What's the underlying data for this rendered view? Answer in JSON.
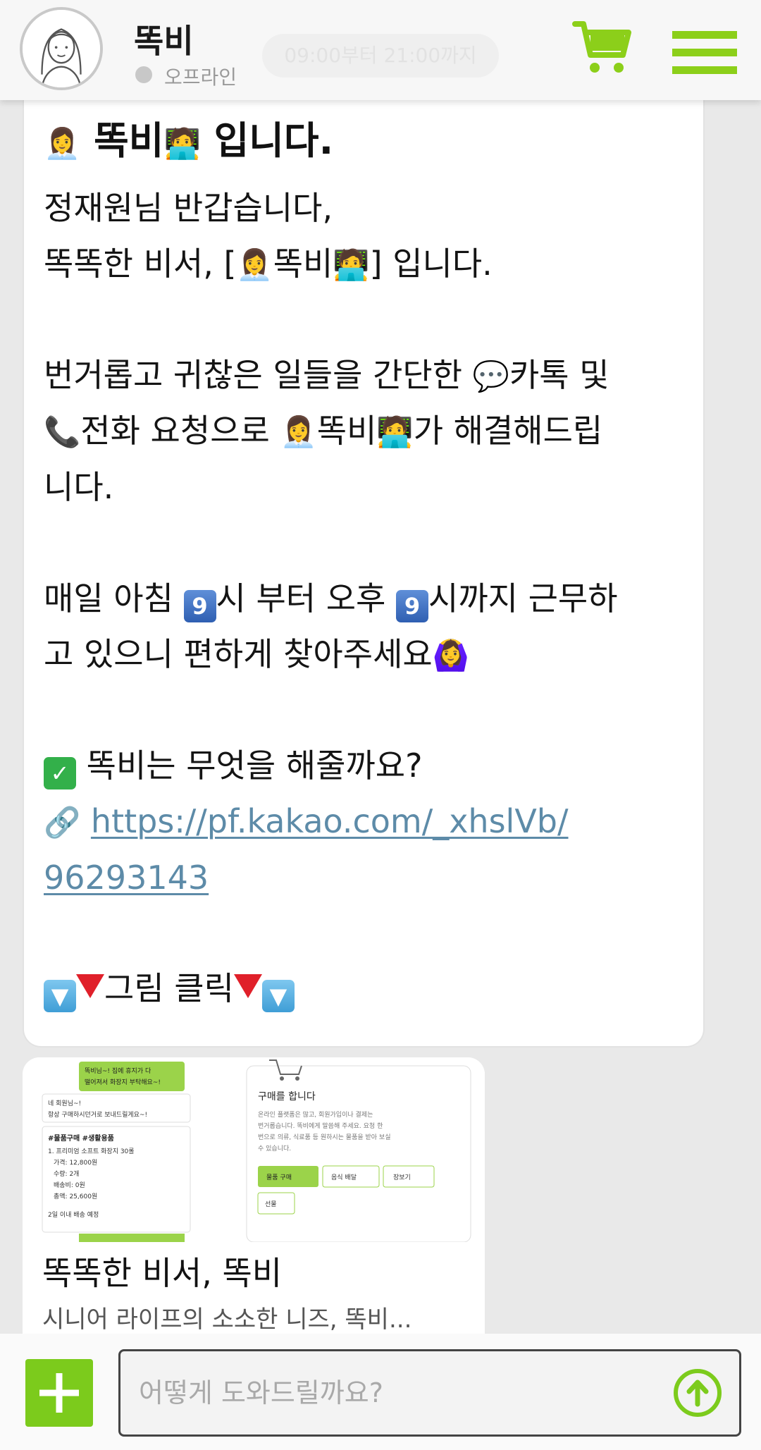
{
  "header": {
    "bot_name": "똑비",
    "status": "오프라인",
    "hours_pill": "09:00부터 21:00까지"
  },
  "message": {
    "title_pre": "",
    "title_name": " 똑비",
    "title_post": " 입니다.",
    "greeting_line1": "정재원님 반갑습니다,",
    "greeting_line2_pre": "똑똑한 비서, [",
    "greeting_line2_name": "똑비",
    "greeting_line2_post": "] 입니다.",
    "service_line1": "번거롭고 귀찮은 일들을 간단한 ",
    "service_line1_kakao": "카톡 및",
    "service_line2_call": "전화 요청으로 ",
    "service_line2_name": "똑비",
    "service_line2_post": "가 해결해드립",
    "service_line3": "니다.",
    "hours_line1_a": "매일 아침 ",
    "hours_line1_b": "시 부터 오후 ",
    "hours_line1_c": "시까지 근무하",
    "hours_num": "9",
    "hours_line2": "고 있으니 편하게 찾아주세요",
    "what_title": " 똑비는 무엇을 해줄까요?",
    "link_line1": "https://pf.kakao.com/_xhslVb/",
    "link_line2": "96293143",
    "click_text": "그림 클릭"
  },
  "card": {
    "title": "똑똑한 비서, 똑비",
    "description": "시니어 라이프의 소소한 니즈, 똑비...",
    "preview": {
      "bubble1": "똑비님~! 집에 휴지가 다",
      "bubble1b": "떨어져서 화장지 부탁해요~!",
      "reply1": "네 회원님~!",
      "reply1b": "항상 구매하시던거로 보내드릴게요~!",
      "order_tags": "#물품구매  #생활용품",
      "order_item": "1. 프리미엄 소프트 화장지 30롤",
      "order_price": "가격: 12,800원",
      "order_qty": "수량: 2개",
      "order_ship": "배송비: 0원",
      "order_total": "총액: 25,600원",
      "order_eta": "2일 이내 배송 예정",
      "purchase_title": "구매를 합니다",
      "purchase_body1": "온라인 플랫폼은 많고, 회원가입이나 결제는",
      "purchase_body2": "번거롭습니다. 똑비에게 말씀해 주세요. 요청 한",
      "purchase_body3": "번으로 의류, 식료품 등 원하시는 물품을 받아 보실",
      "purchase_body4": "수 있습니다.",
      "btn_buy": "물품 구매",
      "btn_food": "음식 배달",
      "btn_shop": "장보기",
      "btn_gift": "선물"
    }
  },
  "input": {
    "placeholder": "어떻게 도와드릴까요?"
  },
  "colors": {
    "accent": "#8ccf1a",
    "link": "#5d8ba8"
  },
  "icons": [
    "avatar-illustration",
    "cart-icon",
    "menu-icon",
    "plus-icon",
    "send-arrow-icon"
  ]
}
